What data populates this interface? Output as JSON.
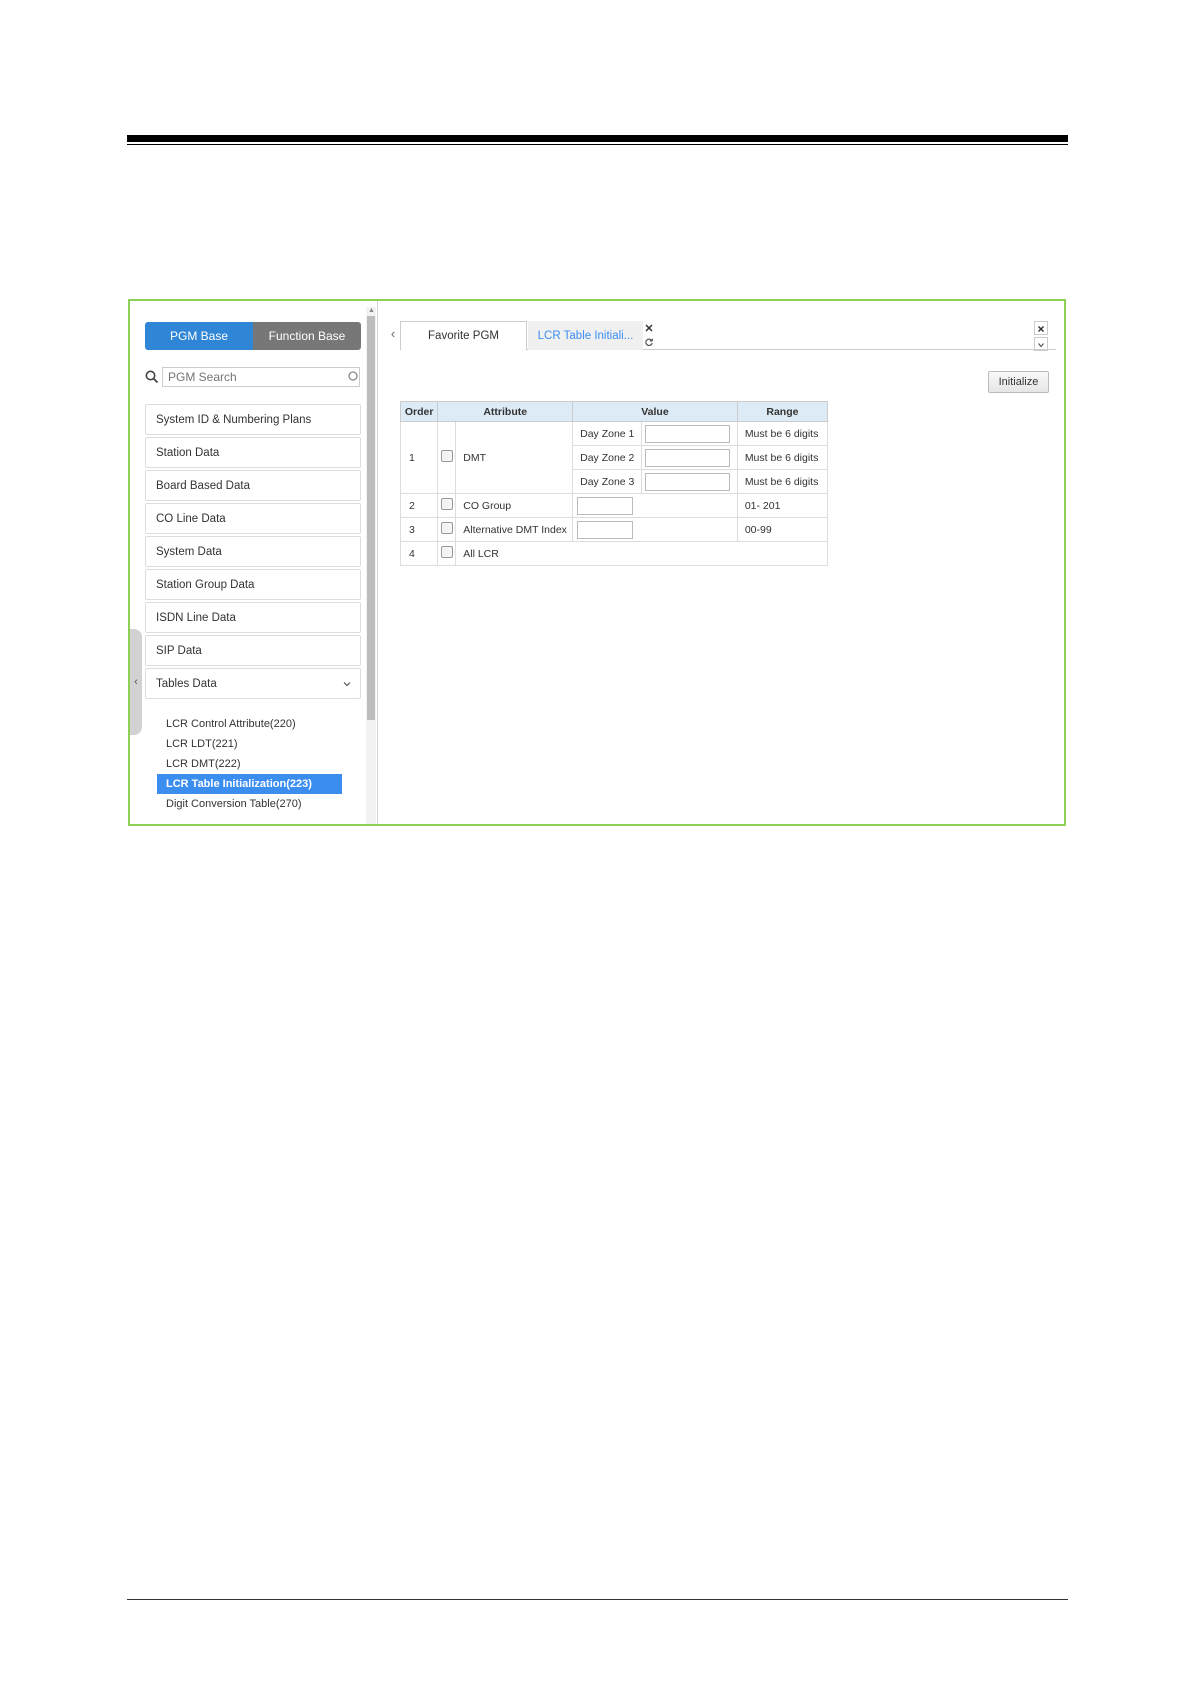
{
  "sidebar": {
    "mode_buttons": {
      "pgm_base": "PGM Base",
      "function_base": "Function Base"
    },
    "search": {
      "placeholder": "PGM Search",
      "value": ""
    },
    "menu": [
      "System ID & Numbering Plans",
      "Station Data",
      "Board Based Data",
      "CO Line Data",
      "System Data",
      "Station Group Data",
      "ISDN Line Data",
      "SIP Data",
      "Tables Data"
    ],
    "submenu": [
      "LCR Control Attribute(220)",
      "LCR LDT(221)",
      "LCR DMT(222)",
      "LCR Table Initialization(223)",
      "Digit Conversion Table(270)"
    ],
    "selected_submenu": "LCR Table Initialization(223)"
  },
  "tabs": [
    {
      "label": "Favorite PGM",
      "active": false
    },
    {
      "label": "LCR Table Initiali...",
      "active": true
    }
  ],
  "actions": {
    "initialize": "Initialize"
  },
  "table": {
    "headers": [
      "Order",
      "Attribute",
      "Value",
      "Range"
    ],
    "dmt": {
      "order": "1",
      "attribute": "DMT",
      "zones": [
        {
          "label": "Day Zone 1",
          "value": "",
          "range": "Must be 6 digits"
        },
        {
          "label": "Day Zone 2",
          "value": "",
          "range": "Must be 6 digits"
        },
        {
          "label": "Day Zone 3",
          "value": "",
          "range": "Must be 6 digits"
        }
      ]
    },
    "co_group": {
      "order": "2",
      "attribute": "CO Group",
      "value": "",
      "range": "01- 201"
    },
    "alt_dmt": {
      "order": "3",
      "attribute": "Alternative DMT Index",
      "value": "",
      "range": "00-99"
    },
    "all_lcr": {
      "order": "4",
      "attribute": "All LCR"
    }
  },
  "colors": {
    "frame_border": "#8fcf55",
    "active_mode": "#2f86d6",
    "inactive_mode": "#777777",
    "selected_item": "#3b8ef0",
    "table_header": "#dcebf6"
  }
}
